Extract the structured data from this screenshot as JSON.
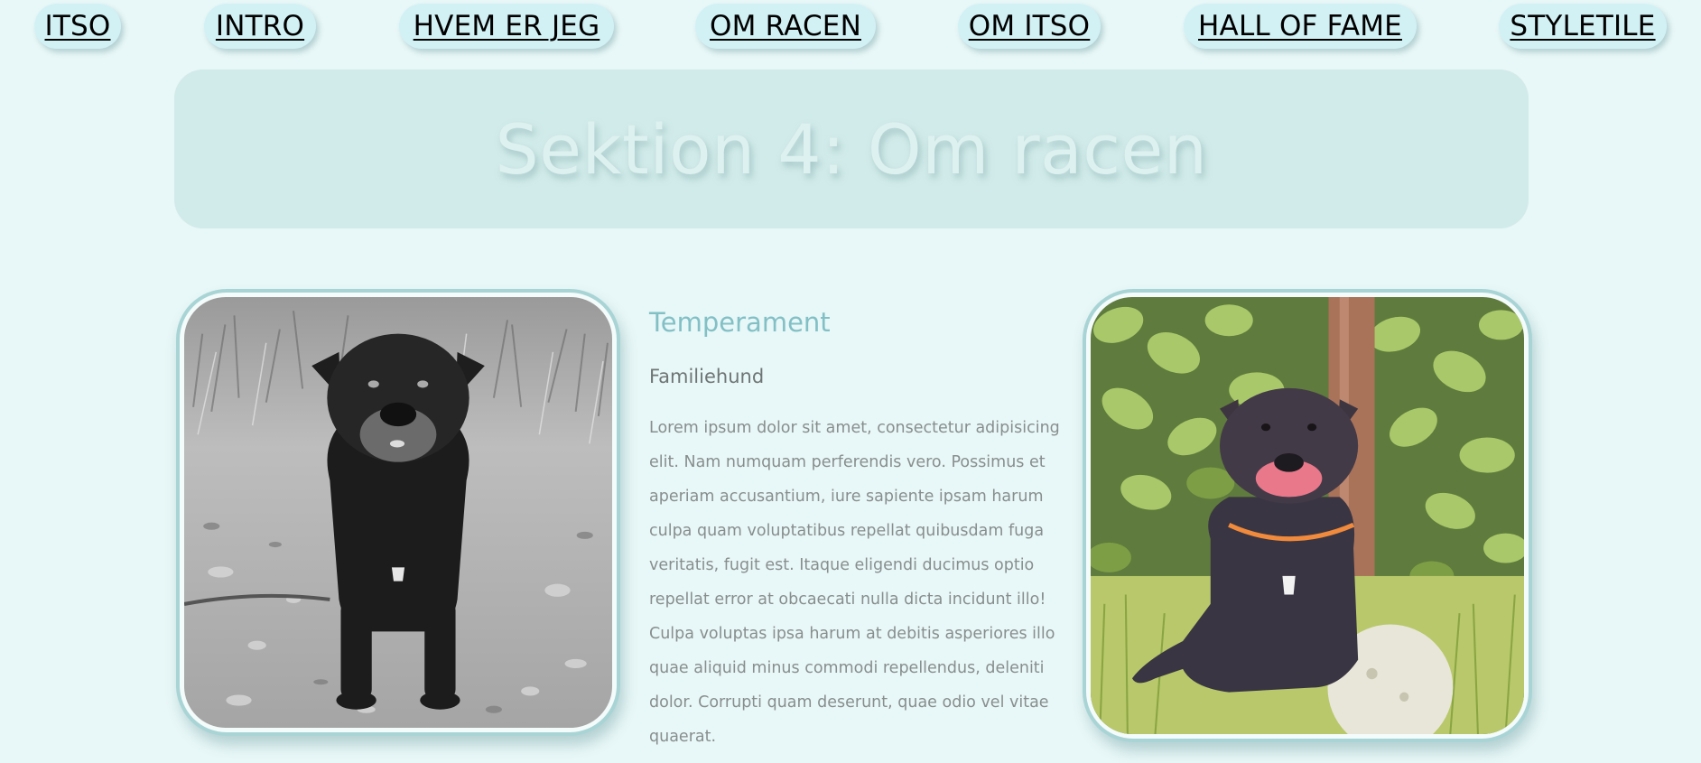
{
  "nav": {
    "items": [
      {
        "label": "ITSO"
      },
      {
        "label": "INTRO"
      },
      {
        "label": "HVEM ER JEG"
      },
      {
        "label": "OM RACEN"
      },
      {
        "label": "OM ITSO"
      },
      {
        "label": "HALL OF FAME"
      },
      {
        "label": "STYLETILE"
      }
    ]
  },
  "hero": {
    "title": "Sektion 4: Om racen"
  },
  "content": {
    "heading": "Temperament",
    "subheading": "Familiehund",
    "paragraph": "Lorem ipsum dolor sit amet, consectetur adipisicing elit. Nam numquam perferendis vero. Possimus et aperiam accusantium, iure sapiente ipsam harum culpa quam voluptatibus repellat quibusdam fuga veritatis, fugit est. Itaque eligendi ducimus optio repellat error at obcaecati nulla dicta incidunt illo! Culpa voluptas ipsa harum at debitis asperiores illo quae aliquid minus commodi repellendus, deleniti dolor. Corrupti quam deserunt, quae odio vel vitae quaerat."
  },
  "colors": {
    "page_background": "#e8f7f7",
    "nav_pill": "#d2f1f5",
    "hero_background": "#d1ebea",
    "heading_accent": "#82c0c6",
    "frame_border": "#a9d4d5"
  },
  "images": {
    "left": "dog-black-and-white-photo",
    "right": "dog-color-photo"
  }
}
